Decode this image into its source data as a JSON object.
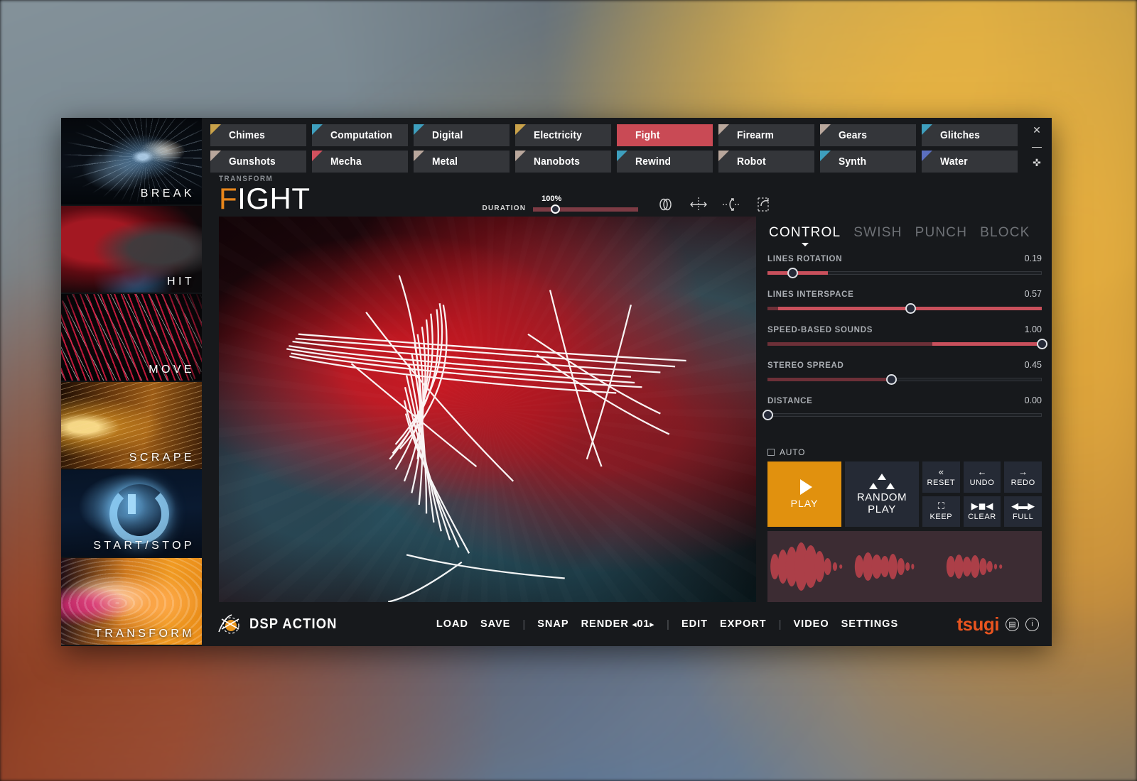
{
  "window": {
    "close_icon": "✕",
    "minimize_icon": "—",
    "pin_icon": "✜"
  },
  "sidebar": {
    "items": [
      {
        "label": "BREAK",
        "art": "art-break"
      },
      {
        "label": "HIT",
        "art": "art-hit"
      },
      {
        "label": "MOVE",
        "art": "art-move"
      },
      {
        "label": "SCRAPE",
        "art": "art-scrape"
      },
      {
        "label": "START/STOP",
        "art": "art-start"
      },
      {
        "label": "TRANSFORM",
        "art": "art-transform"
      }
    ]
  },
  "categories": {
    "active": "Fight",
    "items": [
      {
        "label": "Chimes",
        "color": "#c9a24a"
      },
      {
        "label": "Computation",
        "color": "#3e9fbe"
      },
      {
        "label": "Digital",
        "color": "#3e9fbe"
      },
      {
        "label": "Electricity",
        "color": "#c9a24a"
      },
      {
        "label": "Fight",
        "color": "#c94a55"
      },
      {
        "label": "Firearm",
        "color": "#b9a79c"
      },
      {
        "label": "Gears",
        "color": "#b9a79c"
      },
      {
        "label": "Glitches",
        "color": "#3e9fbe"
      },
      {
        "label": "Gunshots",
        "color": "#b9a79c"
      },
      {
        "label": "Mecha",
        "color": "#d2515e"
      },
      {
        "label": "Metal",
        "color": "#b9a79c"
      },
      {
        "label": "Nanobots",
        "color": "#b9a79c"
      },
      {
        "label": "Rewind",
        "color": "#3e9fbe"
      },
      {
        "label": "Robot",
        "color": "#b9a79c"
      },
      {
        "label": "Synth",
        "color": "#3e9fbe"
      },
      {
        "label": "Water",
        "color": "#5b6fc0"
      }
    ]
  },
  "header": {
    "kicker": "TRANSFORM",
    "title_accent": "F",
    "title_rest": "IGHT",
    "duration_label": "DURATION",
    "duration_value": "100%",
    "duration_knob_pct": 17,
    "tools": [
      {
        "name": "loop-icon"
      },
      {
        "name": "mirror-horizontal-icon"
      },
      {
        "name": "mirror-vertical-icon"
      },
      {
        "name": "crop-select-icon"
      }
    ]
  },
  "panel": {
    "tabs": [
      {
        "label": "CONTROL",
        "active": true
      },
      {
        "label": "SWISH",
        "active": false
      },
      {
        "label": "PUNCH",
        "active": false
      },
      {
        "label": "BLOCK",
        "active": false
      }
    ],
    "sliders": [
      {
        "name": "LINES ROTATION",
        "value": "0.19",
        "pct": 9,
        "mode": "knob",
        "pre": 3
      },
      {
        "name": "LINES INTERSPACE",
        "value": "0.57",
        "pct": 52,
        "mode": "knob",
        "pre": 2
      },
      {
        "name": "SPEED-BASED SOUNDS",
        "value": "1.00",
        "pct": 100,
        "mode": "knob",
        "pre": 64
      },
      {
        "name": "STEREO SPREAD",
        "value": "0.45",
        "pct": 45,
        "mode": "knobdim",
        "pre": 0
      },
      {
        "name": "DISTANCE",
        "value": "0.00",
        "pct": 0,
        "mode": "empty",
        "pre": 0
      }
    ],
    "auto_label": "AUTO",
    "auto_checked": false,
    "play_label": "PLAY",
    "random_play_label": "RANDOM\nPLAY",
    "random_play_line1": "RANDOM",
    "random_play_line2": "PLAY",
    "mini_buttons": [
      {
        "label": "RESET",
        "icon": "«"
      },
      {
        "label": "UNDO",
        "icon": "←"
      },
      {
        "label": "REDO",
        "icon": "→"
      },
      {
        "label": "KEEP",
        "icon": "⛶"
      },
      {
        "label": "CLEAR",
        "icon": "▶◼◀"
      },
      {
        "label": "FULL",
        "icon": "◀▬▶"
      }
    ]
  },
  "footer": {
    "brand": "DSP ACTION",
    "menu": [
      {
        "label": "LOAD",
        "type": "item"
      },
      {
        "label": "SAVE",
        "type": "item"
      },
      {
        "label": "|",
        "type": "sep"
      },
      {
        "label": "SNAP",
        "type": "item"
      },
      {
        "label": "RENDER",
        "type": "render",
        "value": "01"
      },
      {
        "label": "|",
        "type": "sep"
      },
      {
        "label": "EDIT",
        "type": "item"
      },
      {
        "label": "EXPORT",
        "type": "item"
      },
      {
        "label": "|",
        "type": "sep"
      },
      {
        "label": "VIDEO",
        "type": "item"
      },
      {
        "label": "SETTINGS",
        "type": "item"
      }
    ],
    "vendor": "tsugi",
    "doc_icon": "▤",
    "info_icon": "i"
  },
  "colors": {
    "accent_red": "#c94a55",
    "accent_orange": "#e1910e",
    "panel_bg": "#17191c",
    "button_bg": "#252a35",
    "vendor": "#e8541f"
  }
}
